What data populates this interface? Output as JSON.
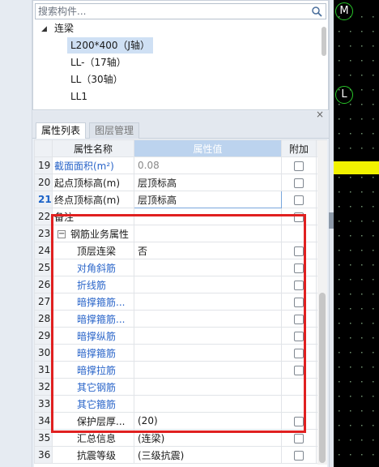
{
  "search": {
    "placeholder": "搜索构件..."
  },
  "tree": {
    "root": "连梁",
    "toggle": "◢",
    "items": [
      {
        "label": "L200*400（J轴）",
        "selected": true
      },
      {
        "label": "LL-（17轴）",
        "selected": false
      },
      {
        "label": "LL（30轴）",
        "selected": false
      },
      {
        "label": "LL1",
        "selected": false
      }
    ]
  },
  "panel": {
    "close": "×"
  },
  "tabs": [
    {
      "label": "属性列表"
    },
    {
      "label": "图层管理"
    }
  ],
  "grid": {
    "headers": {
      "name": "属性名称",
      "value": "属性值",
      "add": "附加"
    },
    "rows": [
      {
        "num": "19",
        "name": "截面面积(m²)",
        "value": "0.08",
        "style": "blue",
        "vstyle": "gray",
        "check": true
      },
      {
        "num": "20",
        "name": "起点顶标高(m)",
        "value": "层顶标高",
        "style": "",
        "check": true
      },
      {
        "num": "21",
        "name": "终点顶标高(m)",
        "value": "层顶标高",
        "style": "",
        "check": true,
        "current": true
      },
      {
        "num": "22",
        "name": "备注",
        "value": "",
        "style": "",
        "check": true
      },
      {
        "num": "23",
        "name": "钢筋业务属性",
        "value": "",
        "style": "",
        "check": false,
        "group": true,
        "toggle": "−"
      },
      {
        "num": "24",
        "name": "顶层连梁",
        "value": "否",
        "style": "",
        "check": true,
        "sub": true
      },
      {
        "num": "25",
        "name": "对角斜筋",
        "value": "",
        "style": "blue",
        "check": true,
        "sub": true
      },
      {
        "num": "26",
        "name": "折线筋",
        "value": "",
        "style": "blue",
        "check": true,
        "sub": true
      },
      {
        "num": "27",
        "name": "暗撑箍筋...",
        "value": "",
        "style": "blue",
        "check": true,
        "sub": true
      },
      {
        "num": "28",
        "name": "暗撑箍筋...",
        "value": "",
        "style": "blue",
        "check": true,
        "sub": true
      },
      {
        "num": "29",
        "name": "暗撑纵筋",
        "value": "",
        "style": "blue",
        "check": true,
        "sub": true
      },
      {
        "num": "30",
        "name": "暗撑箍筋",
        "value": "",
        "style": "blue",
        "check": true,
        "sub": true
      },
      {
        "num": "31",
        "name": "暗撑拉筋",
        "value": "",
        "style": "blue",
        "check": true,
        "sub": true
      },
      {
        "num": "32",
        "name": "其它钢筋",
        "value": "",
        "style": "blue",
        "check": false,
        "sub": true
      },
      {
        "num": "33",
        "name": "其它箍筋",
        "value": "",
        "style": "blue",
        "check": false,
        "sub": true
      },
      {
        "num": "34",
        "name": "保护层厚...",
        "value": "(20)",
        "style": "",
        "check": true,
        "sub": true
      },
      {
        "num": "35",
        "name": "汇总信息",
        "value": "(连梁)",
        "style": "",
        "check": true,
        "sub": true
      },
      {
        "num": "36",
        "name": "抗震等级",
        "value": "(三级抗震)",
        "style": "",
        "check": true,
        "sub": true
      }
    ]
  },
  "canvas": {
    "axis_labels": [
      "M",
      "L"
    ],
    "background": "#000000",
    "axis_color": "#28c628",
    "highlight_color": "#f2f200"
  },
  "colors": {
    "selection": "#cfe0f4",
    "header_value": "#bcd3ee",
    "annotation_box": "#e02020",
    "link_blue": "#2a65c9"
  }
}
